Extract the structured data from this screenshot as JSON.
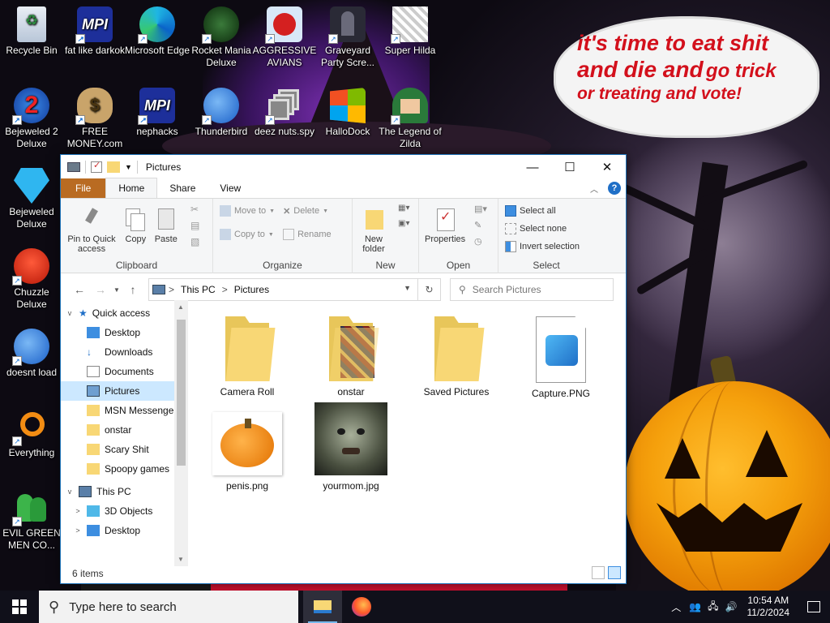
{
  "desktop": {
    "wallpaper_text": {
      "line1": "it's time to eat shit",
      "line2a": "and die and",
      "line2b": "go trick",
      "line3": "or treating and vote!"
    },
    "icons": [
      {
        "label": "Recycle Bin",
        "icon": "recycle-bin-icon"
      },
      {
        "label": "fat like darkok",
        "icon": "mpi-logo-icon"
      },
      {
        "label": "Microsoft Edge",
        "icon": "edge-icon"
      },
      {
        "label": "Rocket Mania Deluxe",
        "icon": "rocket-mania-icon"
      },
      {
        "label": "AGGRESSIVE AVIANS",
        "icon": "angry-bird-icon"
      },
      {
        "label": "Graveyard Party Scre...",
        "icon": "graveyard-icon"
      },
      {
        "label": "Super Hilda",
        "icon": "super-hilda-icon"
      },
      {
        "label": "Bejeweled 2 Deluxe",
        "icon": "bejeweled2-icon"
      },
      {
        "label": "FREE MONEY.com",
        "icon": "money-bag-icon"
      },
      {
        "label": "nephacks",
        "icon": "mpi-logo-icon"
      },
      {
        "label": "Thunderbird",
        "icon": "thunderbird-icon"
      },
      {
        "label": "deez nuts.spy",
        "icon": "stacked-windows-icon"
      },
      {
        "label": "HalloDock",
        "icon": "windows-logo-icon"
      },
      {
        "label": "The Legend of Zilda",
        "icon": "zilda-icon"
      },
      {
        "label": "Bejeweled Deluxe",
        "icon": "diamond-icon"
      },
      {
        "label": "Chuzzle Deluxe",
        "icon": "chuzzle-icon"
      },
      {
        "label": "doesnt load",
        "icon": "thunderbird-icon"
      },
      {
        "label": "Everything",
        "icon": "everything-search-icon"
      },
      {
        "label": "EVIL GREEN MEN CO...",
        "icon": "green-men-icon"
      }
    ]
  },
  "explorer": {
    "title": "Pictures",
    "controls": {
      "minimize": "—",
      "maximize": "☐",
      "close": "✕"
    },
    "tabs": {
      "file": "File",
      "home": "Home",
      "share": "Share",
      "view": "View"
    },
    "ribbon": {
      "clipboard": {
        "label": "Clipboard",
        "pin": "Pin to Quick access",
        "copy": "Copy",
        "paste": "Paste"
      },
      "organize": {
        "label": "Organize",
        "move_to": "Move to",
        "copy_to": "Copy to",
        "delete": "Delete",
        "rename": "Rename"
      },
      "new": {
        "label": "New",
        "new_folder": "New folder"
      },
      "open": {
        "label": "Open",
        "properties": "Properties"
      },
      "select": {
        "label": "Select",
        "select_all": "Select all",
        "select_none": "Select none",
        "invert": "Invert selection"
      }
    },
    "address": {
      "crumb1": "This PC",
      "crumb2": "Pictures",
      "sep": ">"
    },
    "search_placeholder": "Search Pictures",
    "nav": [
      {
        "label": "Quick access",
        "level": 0,
        "exp": "v"
      },
      {
        "label": "Desktop",
        "level": 1,
        "pin": true
      },
      {
        "label": "Downloads",
        "level": 1,
        "pin": true
      },
      {
        "label": "Documents",
        "level": 1,
        "pin": true
      },
      {
        "label": "Pictures",
        "level": 1,
        "pin": true,
        "selected": true
      },
      {
        "label": "MSN Messenger",
        "level": 1
      },
      {
        "label": "onstar",
        "level": 1
      },
      {
        "label": "Scary Shit",
        "level": 1
      },
      {
        "label": "Spoopy games",
        "level": 1
      },
      {
        "label": "This PC",
        "level": 0,
        "exp": "v"
      },
      {
        "label": "3D Objects",
        "level": 1,
        "exp": ">"
      },
      {
        "label": "Desktop",
        "level": 1,
        "exp": ">"
      }
    ],
    "files": [
      {
        "name": "Camera Roll",
        "type": "folder"
      },
      {
        "name": "onstar",
        "type": "folder-thumb"
      },
      {
        "name": "Saved Pictures",
        "type": "folder"
      },
      {
        "name": "Capture.PNG",
        "type": "image-file"
      },
      {
        "name": "penis.png",
        "type": "pumpkin-thumb"
      },
      {
        "name": "yourmom.jpg",
        "type": "face-thumb"
      }
    ],
    "status": "6 items"
  },
  "taskbar": {
    "search_placeholder": "Type here to search",
    "time": "10:54 AM",
    "date": "11/2/2024"
  }
}
